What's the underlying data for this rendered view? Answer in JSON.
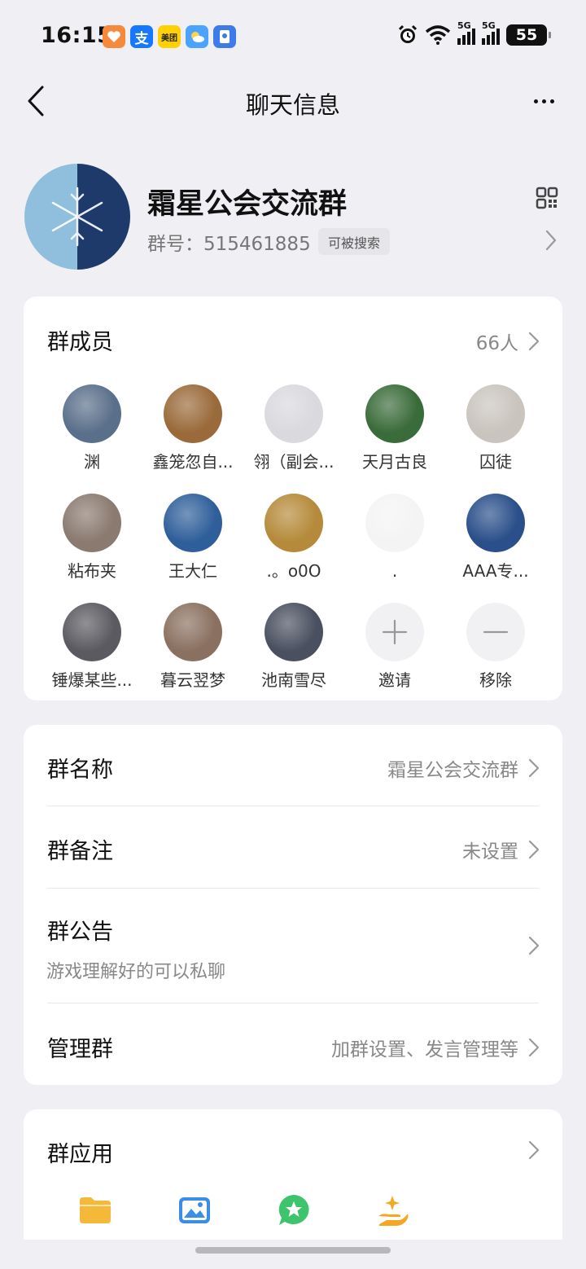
{
  "status": {
    "time": "16:15",
    "apps": [
      "health-app",
      "alipay-app",
      "meituan-app",
      "weather-app",
      "security-app"
    ],
    "meituan_label": "美团",
    "alipay_label": "支",
    "network1": "5G",
    "network2": "5G",
    "battery": "55"
  },
  "nav": {
    "title": "聊天信息"
  },
  "group": {
    "name": "霜星公会交流群",
    "id_label": "群号：515461885",
    "search_badge": "可被搜索"
  },
  "members": {
    "title": "群成员",
    "count": "66人",
    "list": [
      {
        "name": "渊",
        "color": "#5a6f8a"
      },
      {
        "name": "鑫笼忽自...",
        "color": "#9a6a3a"
      },
      {
        "name": "翎（副会...",
        "color": "#d9d9de"
      },
      {
        "name": "天月古良",
        "color": "#3a6b3a"
      },
      {
        "name": "囚徒",
        "color": "#c9c4bd"
      },
      {
        "name": "粘布夹",
        "color": "#8a7a70"
      },
      {
        "name": "王大仁",
        "color": "#2f5f9a"
      },
      {
        "name": ".。o0O",
        "color": "#b58a3a"
      },
      {
        "name": ".",
        "color": "#f4f4f4"
      },
      {
        "name": "AAA专...",
        "color": "#2a4f8a"
      },
      {
        "name": "锤爆某些...",
        "color": "#5a5a60"
      },
      {
        "name": "暮云翌梦",
        "color": "#8a7060"
      },
      {
        "name": "池南雪尽",
        "color": "#4a5060"
      }
    ],
    "invite_label": "邀请",
    "remove_label": "移除"
  },
  "settings": {
    "group_name_label": "群名称",
    "group_name_value": "霜星公会交流群",
    "remark_label": "群备注",
    "remark_value": "未设置",
    "announcement_label": "群公告",
    "announcement_value": "游戏理解好的可以私聊",
    "manage_label": "管理群",
    "manage_value": "加群设置、发言管理等"
  },
  "apps": {
    "title": "群应用",
    "icons": [
      "folder-icon",
      "photo-album-icon",
      "essence-message-icon",
      "group-task-icon"
    ]
  },
  "colors": {
    "background": "#f0f0f4",
    "card": "#ffffff",
    "folder": "#f5b93a",
    "album": "#3b8ee8",
    "essence": "#3ec46d",
    "task": "#f5a623"
  }
}
